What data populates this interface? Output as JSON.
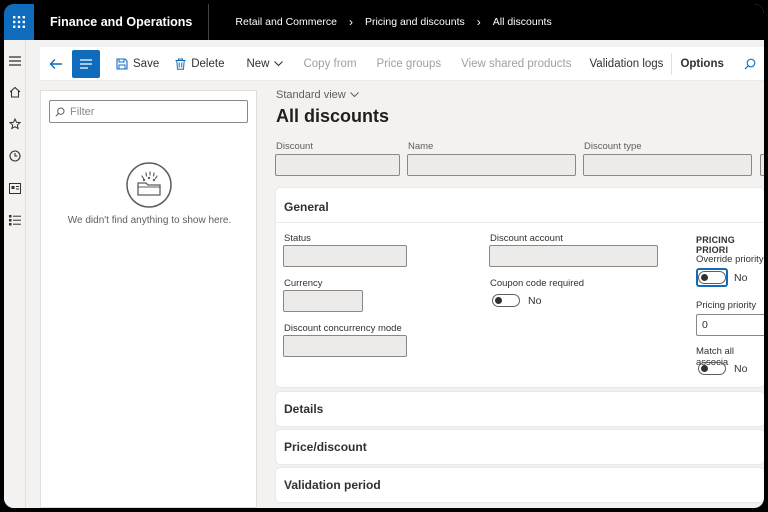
{
  "header": {
    "app_title": "Finance and Operations",
    "breadcrumb": [
      "Retail and Commerce",
      "Pricing and discounts",
      "All discounts"
    ]
  },
  "action_pane": {
    "save": "Save",
    "delete": "Delete",
    "new": "New",
    "copy_from": "Copy from",
    "price_groups": "Price groups",
    "view_shared_products": "View shared products",
    "validation_logs": "Validation logs",
    "options": "Options"
  },
  "filter_pane": {
    "placeholder": "Filter",
    "empty_message": "We didn't find anything to show here."
  },
  "main": {
    "view": "Standard view",
    "title": "All discounts",
    "header_fields": {
      "discount": "Discount",
      "name": "Name",
      "discount_type": "Discount type"
    }
  },
  "general": {
    "title": "General",
    "status": "Status",
    "currency": "Currency",
    "discount_concurrency_mode": "Discount concurrency mode",
    "discount_account": "Discount account",
    "coupon_code_required": "Coupon code required",
    "coupon_value": "No",
    "pricing_priority_section": "PRICING PRIORI",
    "override_priority": "Override priority",
    "override_value": "No",
    "pricing_priority": "Pricing priority",
    "pricing_priority_value": "0",
    "match_all": "Match all associa",
    "match_all_value": "No"
  },
  "sections": {
    "details": "Details",
    "price_discount": "Price/discount",
    "validation_period": "Validation period"
  },
  "colors": {
    "accent": "#0f6cbd",
    "topbar": "#000000"
  }
}
